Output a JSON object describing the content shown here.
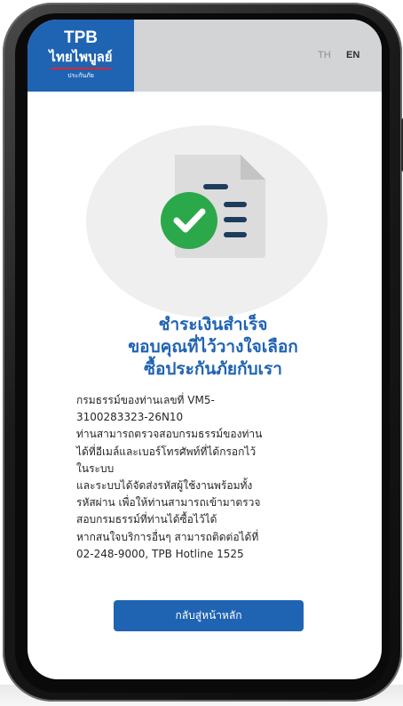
{
  "brand": {
    "name": "TPB",
    "name_thai": "ไทยไพบูลย์",
    "subtitle": "ประกันภัย",
    "color": "#1f63b3",
    "accent": "#e0252b"
  },
  "language_switch": {
    "th_label": "TH",
    "en_label": "EN",
    "selected": "EN"
  },
  "illustration": {
    "icon": "document-with-check-icon",
    "check_color": "#2ba84a",
    "lines_color": "#1e3c5c"
  },
  "title_lines": [
    "ชำระเงินสำเร็จ",
    "ขอบคุณที่ไว้วางใจเลือก",
    "ซื้อประกันภัยกับเรา"
  ],
  "body_lines": [
    "กรมธรรม์ของท่านเลขที่ VM5-",
    "3100283323-26N10",
    "ท่านสามารถตรวจสอบกรมธรรม์ของท่าน",
    "ได้ที่อีเมล์และเบอร์โทรศัพท์ที่ได้กรอกไว้",
    "ในระบบ",
    "และระบบได้จัดส่งรหัสผู้ใช้งานพร้อมทั้ง",
    "รหัสผ่าน เพื่อให้ท่านสามารถเข้ามาตรวจ",
    "สอบกรมธรรม์ที่ท่านได้ซื้อไว้ได้",
    "หากสนใจบริการอื่นๆ สามารถติดต่อได้ที่",
    "02-248-9000, TPB Hotline 1525"
  ],
  "button_label": "กลับสู่หน้าหลัก"
}
